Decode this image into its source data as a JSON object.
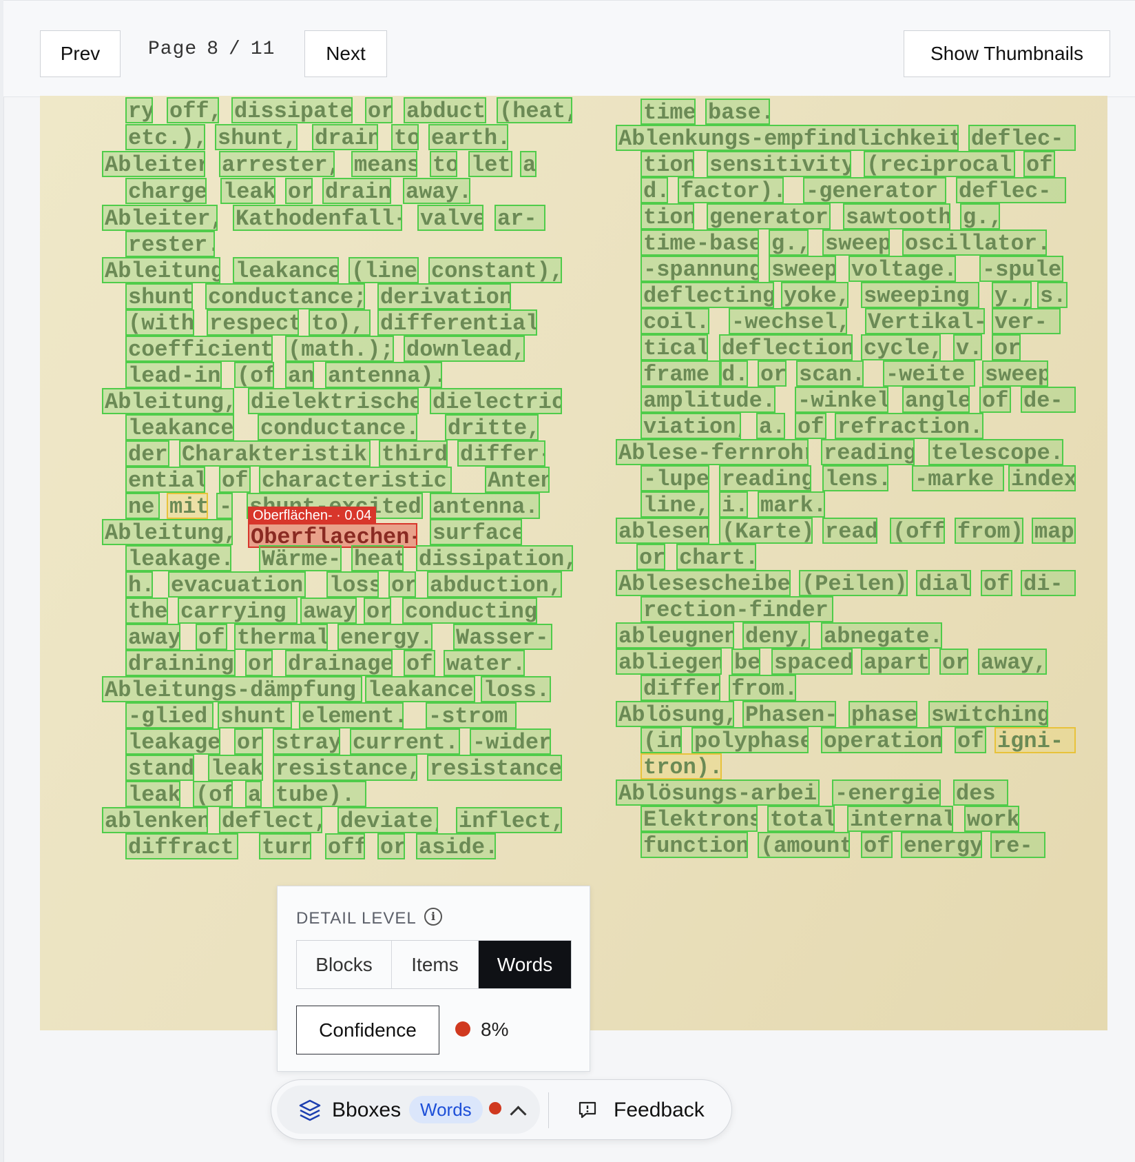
{
  "toolbar": {
    "prev_label": "Prev",
    "next_label": "Next",
    "page_word": "Page",
    "current_page": "8",
    "separator": "/",
    "total_pages": "11",
    "thumbnails_label": "Show Thumbnails"
  },
  "document": {
    "highlight_tag": "Oberflächen- · 0.04",
    "words": {
      "w0": "ry",
      "w1": "off,",
      "w2": "dissipate",
      "w3": "or",
      "w4": "abduct",
      "w5": "(heat,",
      "w6": "etc.),",
      "w7": "shunt,",
      "w8": "drain",
      "w9": "to",
      "w10": "earth.",
      "w11": "Ableiter",
      "w12": "arrester,",
      "w13": "means",
      "w14": "to",
      "w15": "let",
      "w16": "a",
      "w17": "charge",
      "w18": "leak",
      "w19": "or",
      "w20": "drain",
      "w21": "away.",
      "w22": "Ableiter,",
      "w23": "Kathodenfall-",
      "w24": "valve",
      "w25": "ar-",
      "w26": "rester.",
      "w27": "Ableitung",
      "w28": "leakance",
      "w29": "(line",
      "w30": "constant),",
      "w31": "shunt",
      "w32": "conductance;",
      "w33": "derivation",
      "w34": "(with",
      "w35": "respect",
      "w36": "to),",
      "w37": "differential",
      "w38": "coefficient",
      "w39": "(math.);",
      "w40": "downlead,",
      "w41": "lead-in",
      "w42": "(of",
      "w43": "an",
      "w44": "antenna).",
      "w45": "Ableitung,",
      "w46": "dielektrische",
      "w47": "dielectric",
      "w48": "leakance,",
      "w49": "conductance.",
      "w50": "dritte,",
      "w51": "der",
      "w52": "Charakteristik",
      "w53": "third",
      "w54": "differ-",
      "w55": "ential",
      "w56": "of",
      "w57": "characteristic.",
      "w58": "Anten-",
      "w59": "ne",
      "w60": "mit",
      "w61": "-",
      "w62": "shunt-excited",
      "w63": "antenna.",
      "w64": "Ableitung,",
      "w65": "Oberflaechen-",
      "w66": "surface",
      "w67": "leakage.",
      "w68": "Wärme-",
      "w69": "heat",
      "w70": "dissipation,",
      "w71": "h.",
      "w72": "evacuation,",
      "w73": "loss",
      "w74": "or",
      "w75": "abduction,",
      "w76": "the",
      "w77": "carrying",
      "w78": "away",
      "w79": "or",
      "w80": "conducting",
      "w81": "away",
      "w82": "of",
      "w83": "thermal",
      "w84": "energy.",
      "w85": "Wasser-",
      "w86": "draining",
      "w87": "or",
      "w88": "drainage",
      "w89": "of",
      "w90": "water.",
      "w91": "Ableitungs-dämpfung",
      "w92": "leakance",
      "w93": "loss.",
      "w94": "-glied",
      "w95": "shunt",
      "w96": "element.",
      "w97": "-strom",
      "w98": "leakage",
      "w99": "or",
      "w100": "stray",
      "w101": "current.",
      "w102": "-wider-",
      "w103": "stand",
      "w104": "leak",
      "w105": "resistance,",
      "w106": "resistance",
      "w107": "leak",
      "w108": "(of",
      "w109": "a",
      "w110": "tube).",
      "w111": "ablenken",
      "w112": "deflect,",
      "w113": "deviate,",
      "w114": "inflect,",
      "w115": "diffract;",
      "w116": "turn",
      "w117": "off",
      "w118": "or",
      "w119": "aside.",
      "r0": "time",
      "r1": "base.",
      "r2": "Ablenkungs-empfindlichkeit",
      "r3": "deflec-",
      "r4": "tion",
      "r5": "sensitivity",
      "r6": "(reciprocal",
      "r7": "of",
      "r8": "d.",
      "r9": "factor).",
      "r10": "-generator",
      "r11": "deflec-",
      "r12": "tion",
      "r13": "generator,",
      "r14": "sawtooth",
      "r15": "g.,",
      "r16": "time-base",
      "r17": "g.,",
      "r18": "sweep",
      "r19": "oscillator.",
      "r20": "-spannung",
      "r21": "sweep",
      "r22": "voltage.",
      "r23": "-spule",
      "r24": "deflecting",
      "r25": "yoke,",
      "r26": "sweeping",
      "r27": "y.,",
      "r28": "s.",
      "r29": "coil.",
      "r30": "-wechsel,",
      "r31": "Vertikal-",
      "r32": "ver-",
      "r33": "tical",
      "r34": "deflection",
      "r35": "cycle,",
      "r36": "v.",
      "r37": "or",
      "r38": "frame",
      "r39": "d.",
      "r40": "or",
      "r41": "scan.",
      "r42": "-weite",
      "r43": "sweep",
      "r44": "amplitude.",
      "r45": "-winkel",
      "r46": "angle",
      "r47": "of",
      "r48": "de-",
      "r49": "viation,",
      "r50": "a.",
      "r51": "of",
      "r52": "refraction.",
      "r53": "Ablese-fernrohr",
      "r54": "reading",
      "r55": "telescope.",
      "r56": "-lupe",
      "r57": "reading",
      "r58": "lens.",
      "r59": "-marke",
      "r60": "index",
      "r61": "line,",
      "r62": "i.",
      "r63": "mark.",
      "r64": "ablesen",
      "r65": "(Karte)",
      "r66": "read",
      "r67": "(off",
      "r68": "from)",
      "r69": "map",
      "r70": "or",
      "r71": "chart.",
      "r72": "Ablesescheibe",
      "r73": "(Peilen)",
      "r74": "dial",
      "r75": "of",
      "r76": "di-",
      "r77": "rection-finder.",
      "r78": "ableugnen",
      "r79": "deny,",
      "r80": "abnegate.",
      "r81": "abliegen",
      "r82": "be",
      "r83": "spaced",
      "r84": "apart",
      "r85": "or",
      "r86": "away,",
      "r87": "differ",
      "r88": "from.",
      "r89": "Ablösung,",
      "r90": "Phasen-",
      "r91": "phase",
      "r92": "switching",
      "r93": "(in",
      "r94": "polyphase",
      "r95": "operation",
      "r96": "of",
      "r97": "igni-",
      "r98": "tron).",
      "r99": "Ablösungs-arbeit,",
      "r100": "-energie",
      "r101": "des",
      "r102": "Elektrons",
      "r103": "total",
      "r104": "internal",
      "r105": "work",
      "r106": "function",
      "r107": "(amount",
      "r108": "of",
      "r109": "energy",
      "r110": "re-"
    }
  },
  "detail_panel": {
    "title": "DETAIL LEVEL",
    "options": [
      "Blocks",
      "Items",
      "Words"
    ],
    "selected": "Words",
    "confidence_label": "Confidence",
    "confidence_value": "8%",
    "confidence_color": "#d0391f"
  },
  "bottom_bar": {
    "bboxes_label": "Bboxes",
    "mode_badge": "Words",
    "feedback_label": "Feedback",
    "icons": [
      "layers-icon",
      "chevron-up-icon",
      "feedback-icon"
    ]
  },
  "colors": {
    "box_ok": "#4fcc4a",
    "box_low": "#d8362b",
    "box_mid": "#e8c23a",
    "selected_segment": "#0f1115"
  }
}
